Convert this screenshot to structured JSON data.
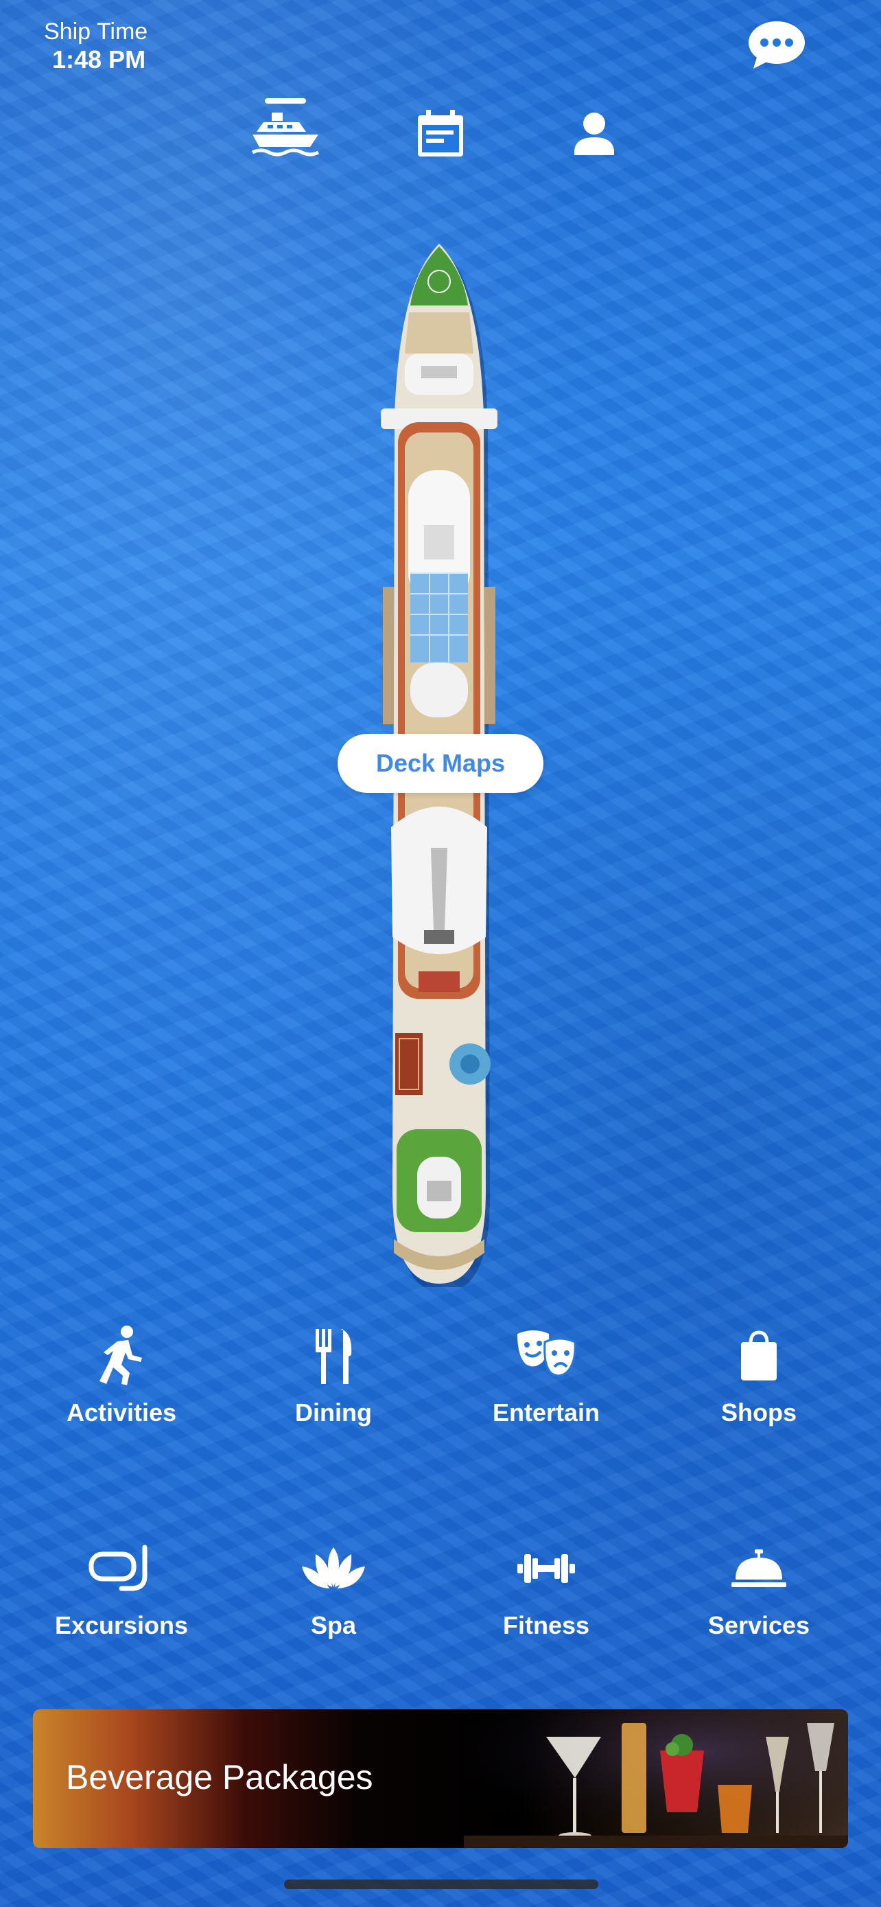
{
  "status": {
    "ship_time_label": "Ship Time",
    "ship_time_value": "1:48 PM"
  },
  "nav": {
    "tabs": [
      {
        "icon": "ship-icon",
        "active": true
      },
      {
        "icon": "calendar-icon",
        "active": false
      },
      {
        "icon": "profile-icon",
        "active": false
      }
    ]
  },
  "deck_maps_label": "Deck Maps",
  "categories": [
    {
      "label": "Activities",
      "icon": "activities-icon"
    },
    {
      "label": "Dining",
      "icon": "dining-icon"
    },
    {
      "label": "Entertain",
      "icon": "entertainment-icon"
    },
    {
      "label": "Shops",
      "icon": "shopping-bag-icon"
    },
    {
      "label": "Excursions",
      "icon": "snorkel-mask-icon"
    },
    {
      "label": "Spa",
      "icon": "lotus-icon"
    },
    {
      "label": "Fitness",
      "icon": "dumbbell-icon"
    },
    {
      "label": "Services",
      "icon": "service-bell-icon"
    }
  ],
  "promo": {
    "label": "Beverage Packages"
  },
  "colors": {
    "ocean": "#2278e0",
    "accent": "#3f8ae8"
  }
}
